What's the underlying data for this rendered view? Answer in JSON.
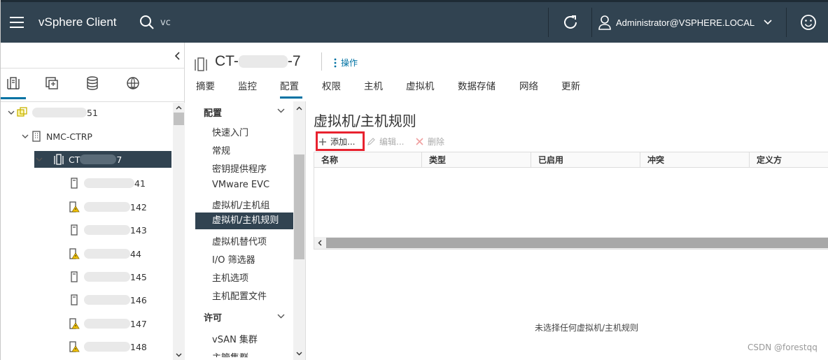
{
  "header": {
    "app_title": "vSphere Client",
    "search_value": "vc",
    "user": "Administrator@VSPHERE.LOCAL"
  },
  "tree": {
    "nodes": [
      {
        "label": "51"
      },
      {
        "label": "NMC-CTRP"
      },
      {
        "label_start": "CT",
        "label_end": "7"
      },
      {
        "label": "41"
      },
      {
        "label": "142"
      },
      {
        "label": "143"
      },
      {
        "label": "44"
      },
      {
        "label": "145"
      },
      {
        "label": "146"
      },
      {
        "label": "147"
      },
      {
        "label": "148"
      }
    ]
  },
  "object": {
    "title_start": "CT-",
    "title_end": "-7",
    "actions_label": "操作"
  },
  "tabs": [
    "摘要",
    "监控",
    "配置",
    "权限",
    "主机",
    "虚拟机",
    "数据存储",
    "网络",
    "更新"
  ],
  "subnav": {
    "section_config": "配置",
    "items": [
      "快速入门",
      "常规",
      "密钥提供程序",
      "VMware EVC",
      "虚拟机/主机组",
      "虚拟机/主机规则",
      "虚拟机替代项",
      "I/O 筛选器",
      "主机选项",
      "主机配置文件"
    ],
    "section_license": "许可",
    "license_items": [
      "vSAN 集群",
      "主管集群"
    ]
  },
  "content": {
    "heading": "虚拟机/主机规则",
    "toolbar": {
      "add": "添加...",
      "edit": "编辑...",
      "delete": "删除"
    },
    "columns": [
      "名称",
      "类型",
      "已启用",
      "冲突",
      "定义方"
    ],
    "empty_message": "未选择任何虚拟机/主机规则"
  },
  "watermark": "CSDN @forestqq",
  "colors": {
    "header_bg": "#314351",
    "selection_bg": "#314351",
    "accent": "#0072a3",
    "highlight_box": "#e8222f",
    "warning": "#f0c000"
  }
}
